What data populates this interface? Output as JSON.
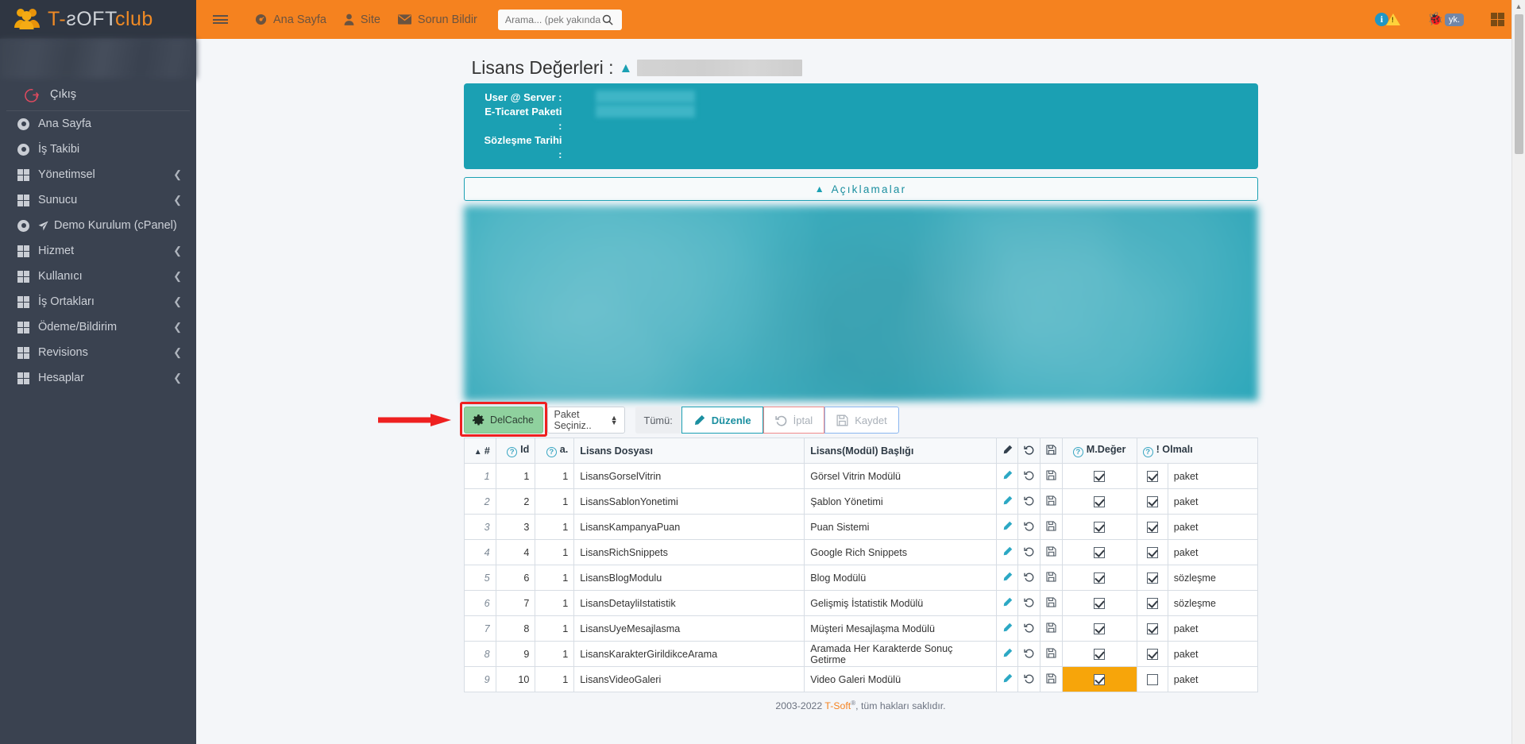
{
  "brand": {
    "part1": "T-",
    "part2": "ƨOF",
    "part3": "T",
    "part4": "club",
    "logo_icon": "people-logo-icon"
  },
  "sidebar": {
    "logout": {
      "label": "Çıkış",
      "icon": "logout-icon"
    },
    "items": [
      {
        "label": "Ana Sayfa",
        "icon": "radio-dot-icon",
        "caret": "",
        "has_caret": false
      },
      {
        "label": "İş Takibi",
        "icon": "radio-dot-icon",
        "caret": "",
        "has_caret": false
      },
      {
        "label": "Yönetimsel",
        "icon": "grid-icon",
        "caret": "❮",
        "has_caret": true
      },
      {
        "label": "Sunucu",
        "icon": "grid-icon",
        "caret": "❮",
        "has_caret": true
      },
      {
        "label": "Demo Kurulum (cPanel)",
        "icon": "radio-dot-icon",
        "caret": "",
        "has_caret": false,
        "sub_icon": "paper-plane-icon"
      },
      {
        "label": "Hizmet",
        "icon": "grid-icon",
        "caret": "❮",
        "has_caret": true
      },
      {
        "label": "Kullanıcı",
        "icon": "grid-icon",
        "caret": "❮",
        "has_caret": true
      },
      {
        "label": "İş Ortakları",
        "icon": "grid-icon",
        "caret": "❮",
        "has_caret": true
      },
      {
        "label": "Ödeme/Bildirim",
        "icon": "grid-icon",
        "caret": "❮",
        "has_caret": true
      },
      {
        "label": "Revisions",
        "icon": "grid-icon",
        "caret": "❮",
        "has_caret": true
      },
      {
        "label": "Hesaplar",
        "icon": "grid-icon",
        "caret": "❮",
        "has_caret": true
      }
    ]
  },
  "topbar": {
    "menu_icon": "hamburger-icon",
    "links": [
      {
        "label": "Ana Sayfa",
        "icon": "dashboard-icon"
      },
      {
        "label": "Site",
        "icon": "user-icon"
      },
      {
        "label": "Sorun Bildir",
        "icon": "envelope-icon"
      }
    ],
    "search": {
      "placeholder": "Arama... (pek yakında)",
      "value": "",
      "icon": "search-icon"
    },
    "right_icons": [
      {
        "name": "info-icon",
        "glyph": "i"
      },
      {
        "name": "warning-icon",
        "glyph": "!"
      },
      {
        "name": "bug-icon",
        "glyph": "🐞"
      },
      {
        "name": "yk-badge",
        "glyph": "yk."
      },
      {
        "name": "apps-grid-icon",
        "glyph": ""
      }
    ],
    "accent_color": "#f5821f"
  },
  "page": {
    "title": "Lisans Değerleri :",
    "title_caret": "▲",
    "info_panel": {
      "rows": [
        {
          "label": "User @ Server :",
          "value": ""
        },
        {
          "label": "E-Ticaret Paketi :",
          "value": ""
        },
        {
          "label": "Sözleşme Tarihi :",
          "value": ""
        }
      ],
      "bg_color": "#1ba0b3"
    },
    "accordion": {
      "label": "Açıklamalar",
      "caret": "▲"
    }
  },
  "toolbar": {
    "delcache": {
      "label": "DelCache",
      "icon": "gear-icon",
      "color": "#8fd19e",
      "highlighted": true
    },
    "paket_select": {
      "value": "Paket Seçiniz..",
      "icon": "updown-arrows-icon"
    },
    "tumu_label": "Tümü:",
    "duzenle": {
      "label": "Düzenle",
      "icon": "pencil-icon"
    },
    "iptal": {
      "label": "İptal",
      "icon": "undo-icon"
    },
    "kaydet": {
      "label": "Kaydet",
      "icon": "floppy-save-icon"
    },
    "annotation": {
      "arrow_color": "#ee2020",
      "box_color": "#ee2020"
    }
  },
  "table": {
    "headers": {
      "num": "#",
      "sort_caret": "▲",
      "id": "Id",
      "a": "a.",
      "file": "Lisans Dosyası",
      "title": "Lisans(Modül) Başlığı",
      "edit_icon": "pencil-icon",
      "undo_icon": "undo-icon",
      "save_icon": "floppy-save-icon",
      "mdeger": "M.Değer",
      "olmali": "! Olmalı",
      "help_glyph": "?"
    },
    "rows": [
      {
        "num": "1",
        "id": "1",
        "a": "1",
        "file": "LisansGorselVitrin",
        "title": "Görsel Vitrin Modülü",
        "mdeger": true,
        "mdeger_hl": false,
        "olmali": true,
        "olmali_text": "paket"
      },
      {
        "num": "2",
        "id": "2",
        "a": "1",
        "file": "LisansSablonYonetimi",
        "title": "Şablon Yönetimi",
        "mdeger": true,
        "mdeger_hl": false,
        "olmali": true,
        "olmali_text": "paket"
      },
      {
        "num": "3",
        "id": "3",
        "a": "1",
        "file": "LisansKampanyaPuan",
        "title": "Puan Sistemi",
        "mdeger": true,
        "mdeger_hl": false,
        "olmali": true,
        "olmali_text": "paket"
      },
      {
        "num": "4",
        "id": "4",
        "a": "1",
        "file": "LisansRichSnippets",
        "title": "Google Rich Snippets",
        "mdeger": true,
        "mdeger_hl": false,
        "olmali": true,
        "olmali_text": "paket"
      },
      {
        "num": "5",
        "id": "6",
        "a": "1",
        "file": "LisansBlogModulu",
        "title": "Blog Modülü",
        "mdeger": true,
        "mdeger_hl": false,
        "olmali": true,
        "olmali_text": "sözleşme"
      },
      {
        "num": "6",
        "id": "7",
        "a": "1",
        "file": "LisansDetayliIstatistik",
        "title": "Gelişmiş İstatistik Modülü",
        "mdeger": true,
        "mdeger_hl": false,
        "olmali": true,
        "olmali_text": "sözleşme"
      },
      {
        "num": "7",
        "id": "8",
        "a": "1",
        "file": "LisansUyeMesajlasma",
        "title": "Müşteri Mesajlaşma Modülü",
        "mdeger": true,
        "mdeger_hl": false,
        "olmali": true,
        "olmali_text": "paket"
      },
      {
        "num": "8",
        "id": "9",
        "a": "1",
        "file": "LisansKarakterGirildikceArama",
        "title": "Aramada Her Karakterde Sonuç Getirme",
        "mdeger": true,
        "mdeger_hl": false,
        "olmali": true,
        "olmali_text": "paket"
      },
      {
        "num": "9",
        "id": "10",
        "a": "1",
        "file": "LisansVideoGaleri",
        "title": "Video Galeri Modülü",
        "mdeger": true,
        "mdeger_hl": true,
        "olmali": false,
        "olmali_text": "paket"
      }
    ]
  },
  "footer": {
    "years": "2003-2022",
    "brand": "T-Soft",
    "sup": "®",
    "text": ", tüm hakları saklıdır."
  }
}
